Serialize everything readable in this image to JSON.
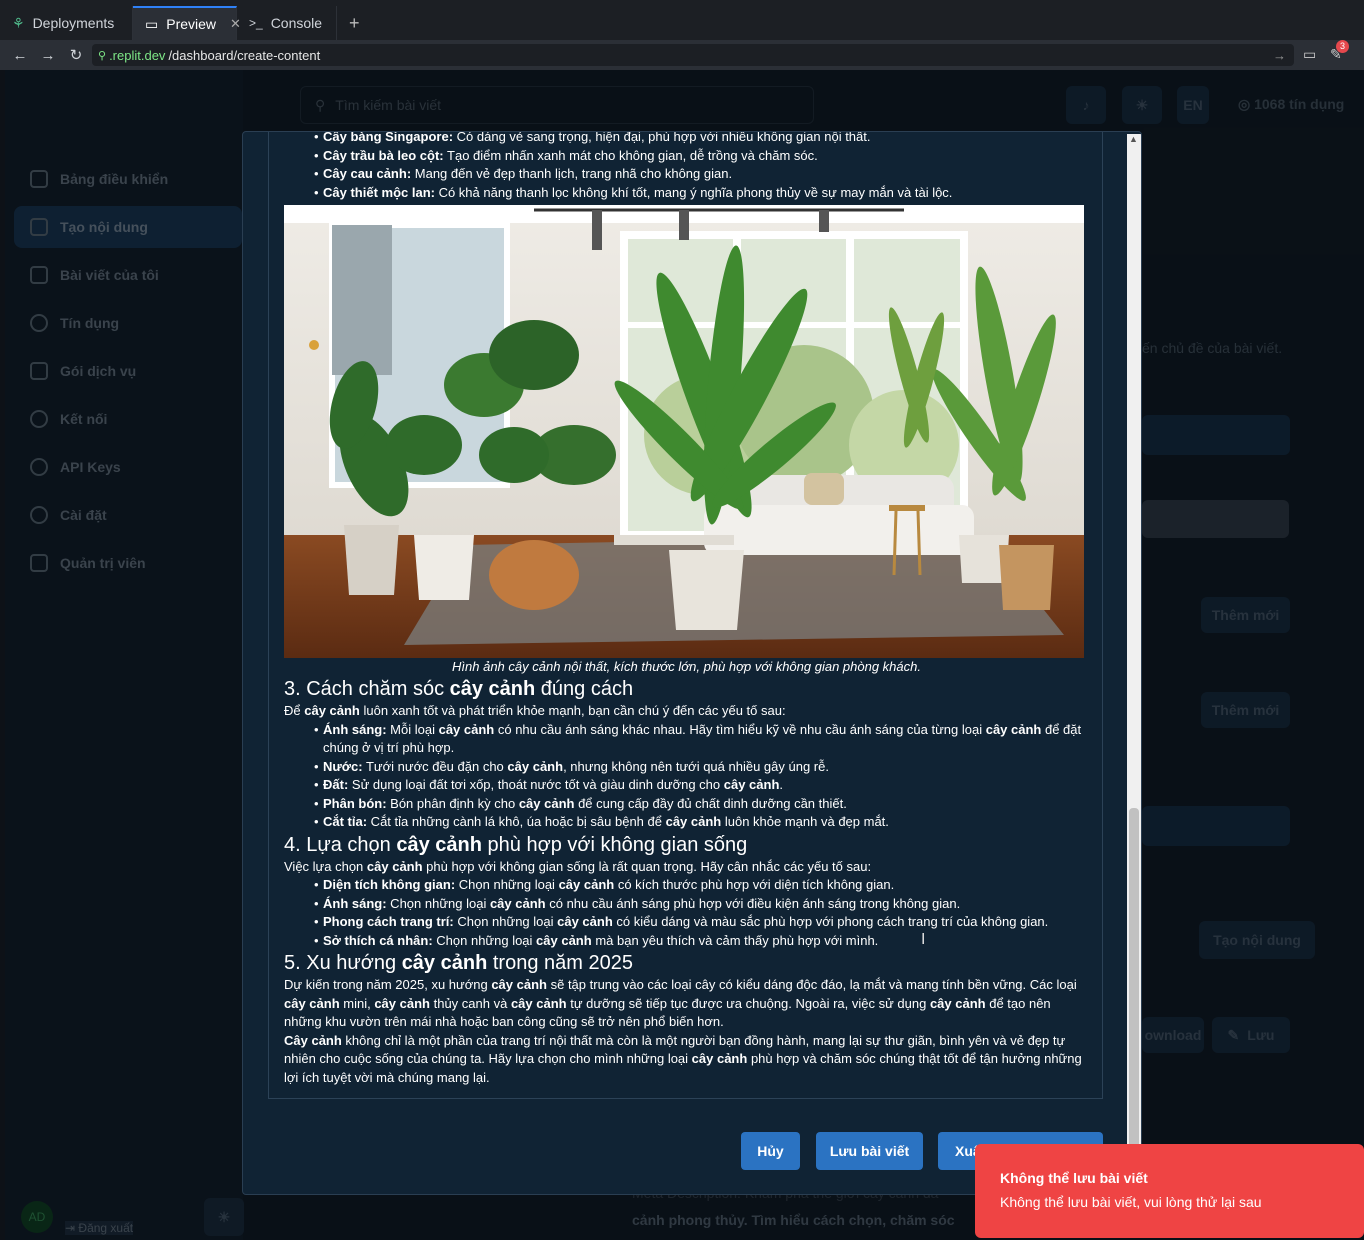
{
  "browser": {
    "tabs": [
      {
        "label": "Deployments"
      },
      {
        "label": "Preview"
      },
      {
        "label": "Console"
      }
    ],
    "url_domain": ".replit.dev",
    "url_path": "/dashboard/create-content",
    "notification_count": "3"
  },
  "sidebar": {
    "items": [
      {
        "label": "Bảng điều khiển"
      },
      {
        "label": "Tạo nội dung"
      },
      {
        "label": "Bài viết của tôi"
      },
      {
        "label": "Tín dụng"
      },
      {
        "label": "Gói dịch vụ"
      },
      {
        "label": "Kết nối"
      },
      {
        "label": "API Keys"
      },
      {
        "label": "Cài đặt"
      },
      {
        "label": "Quản trị viên"
      }
    ],
    "avatar": "AD",
    "logout": "Đăng xuất"
  },
  "header": {
    "search_placeholder": "Tìm kiếm bài viết",
    "lang": "EN",
    "credits": "1068 tín dụng"
  },
  "background": {
    "topic_hint": "ến chủ đề của bài viết.",
    "add_new_1": "Thêm mới",
    "add_new_2": "Thêm mới",
    "create_content": "Tạo nội dung",
    "download": "ownload",
    "save": "Lưu",
    "meta_line1": "Meta Description: Khám phá thế giới cây cảnh đa",
    "meta_line2": "cảnh phong thủy. Tìm hiểu cách chọn, chăm sóc"
  },
  "article": {
    "top_items": [
      {
        "term": "Cây bàng Singapore:",
        "text": " Có dáng vẻ sang trọng, hiện đại, phù hợp với nhiều không gian nội thất."
      },
      {
        "term": "Cây trầu bà leo cột:",
        "text": " Tạo điểm nhấn xanh mát cho không gian, dễ trồng và chăm sóc."
      },
      {
        "term": "Cây cau cảnh:",
        "text": " Mang đến vẻ đẹp thanh lịch, trang nhã cho không gian."
      },
      {
        "term": "Cây thiết mộc lan:",
        "text": " Có khả năng thanh lọc không khí tốt, mang ý nghĩa phong thủy về sự may mắn và tài lộc."
      }
    ],
    "caption": "Hình ảnh cây cảnh nội thất, kích thước lớn, phù hợp với không gian phòng khách.",
    "h3_pre": "3. Cách chăm sóc ",
    "h3_bold": "cây cảnh",
    "h3_post": " đúng cách",
    "h4_pre": "4. Lựa chọn ",
    "h4_bold": "cây cảnh",
    "h4_post": " phù hợp với không gian sống",
    "h5_pre": "5. Xu hướng ",
    "h5_bold": "cây cảnh",
    "h5_post": " trong năm 2025",
    "kw": "cây cảnh",
    "kw_cap": "Cây cảnh"
  },
  "modal": {
    "cancel": "Hủy",
    "save_article": "Lưu bài viết",
    "export": "Xuất bản"
  },
  "toast": {
    "title": "Không thể lưu bài viết",
    "message": "Không thể lưu bài viết, vui lòng thử lại sau"
  }
}
